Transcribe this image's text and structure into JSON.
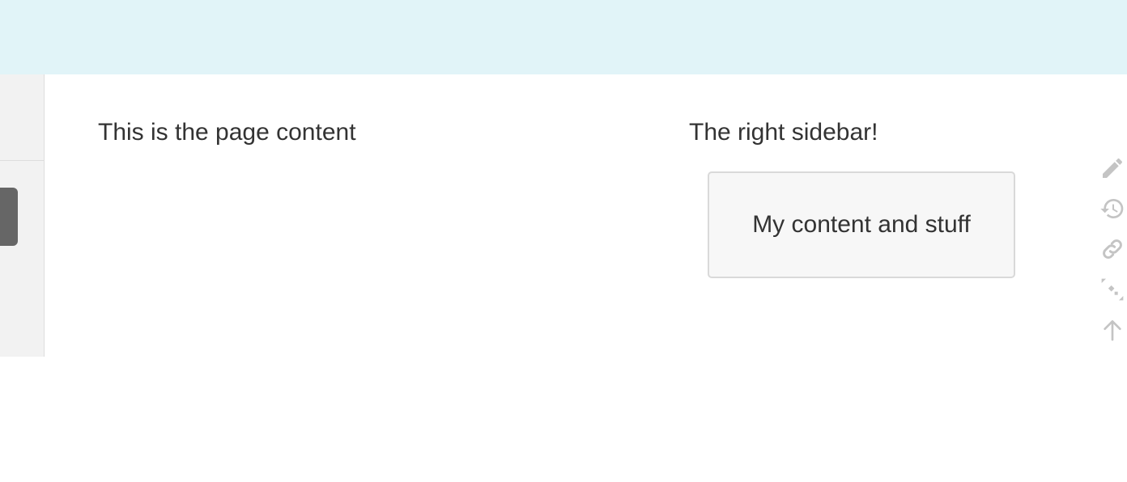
{
  "main": {
    "content_text": "This is the page content"
  },
  "sidebar": {
    "title": "The right sidebar!",
    "box_text": "My content and stuff"
  },
  "tools": {
    "icons": [
      "pencil-icon",
      "history-icon",
      "link-icon",
      "expand-arrows-icon",
      "arrow-up-icon"
    ]
  },
  "colors": {
    "topbar_bg": "#e1f4f8",
    "left_panel_bg": "#f2f2f2",
    "tab_handle": "#666666",
    "sidebar_box_bg": "#f7f7f7",
    "icon_color": "#c4c4c4"
  }
}
